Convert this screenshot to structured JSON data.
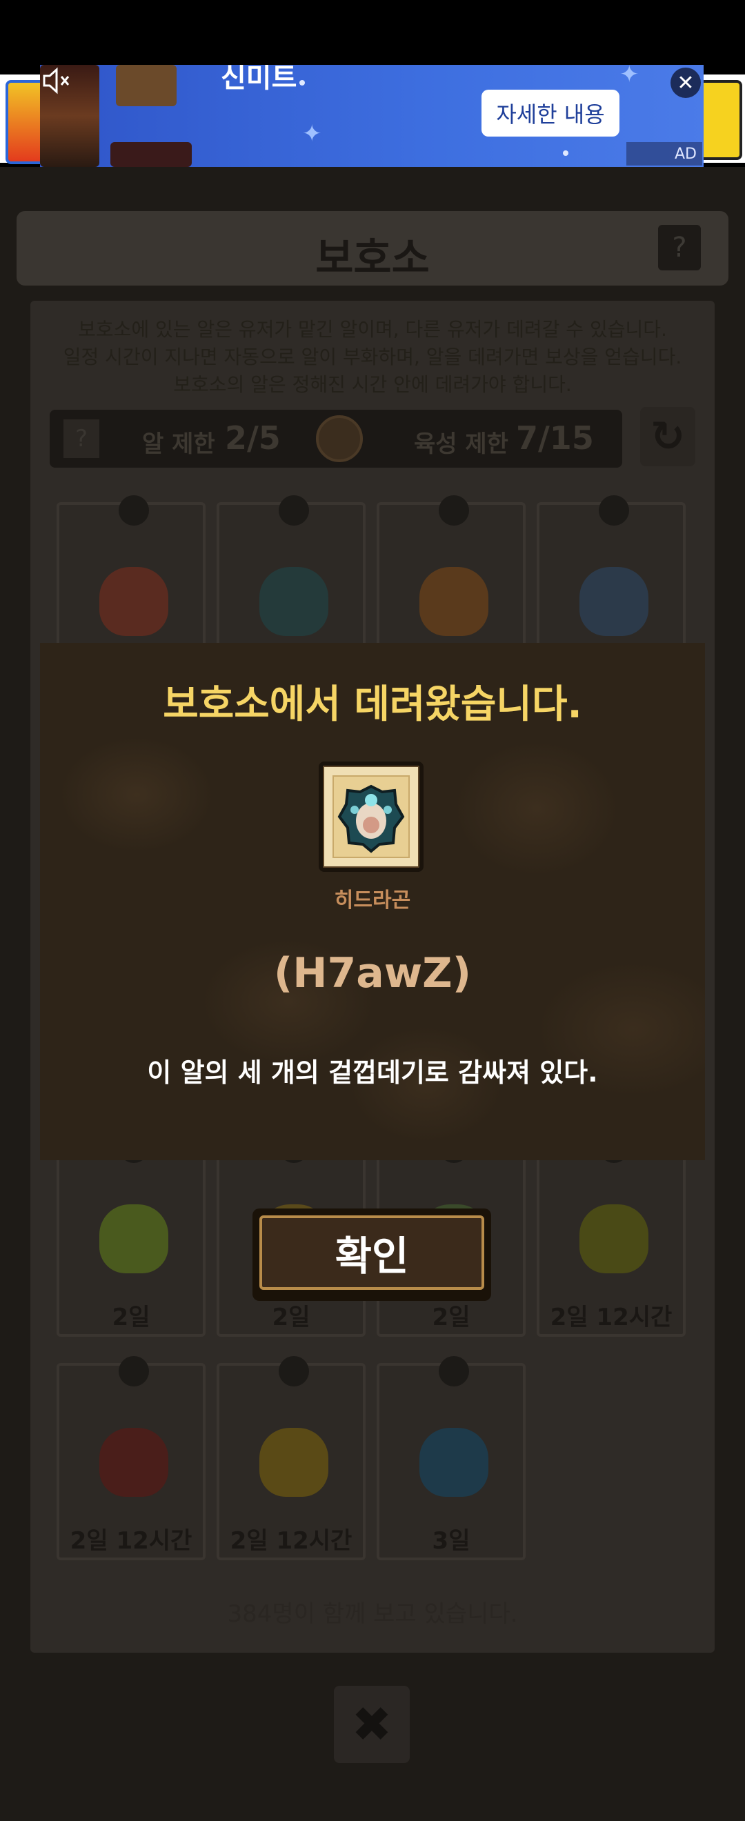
{
  "ad": {
    "title": "신미트",
    "cta_label": "자세한 내용",
    "close_label": "✕",
    "mark": "AD",
    "mute_icon": "speaker-muted-icon"
  },
  "shelter": {
    "title": "보호소",
    "help_label": "?",
    "info_lines": [
      "보호소에 있는 알은 유저가 맡긴 알이며, 다른 유저가 데려갈 수 있습니다.",
      "일정 시간이 지나면 자동으로 알이 부화하며, 알을 데려가면 보상을 얻습니다.",
      "보호소의 알은 정해진 시간 안에 데려가야 합니다."
    ],
    "egg_limit_label": "알 제한",
    "egg_limit_value": "2/5",
    "raise_limit_label": "육성 제한",
    "raise_limit_value": "7/15",
    "refresh_icon": "refresh-icon",
    "eggs": [
      {
        "time": "",
        "color": "#5a2b20"
      },
      {
        "time": "",
        "color": "#243a3a"
      },
      {
        "time": "",
        "color": "#5a3a1c"
      },
      {
        "time": "",
        "color": "#2c3a4a"
      },
      {
        "time": "2일",
        "color": "#4a5a1e"
      },
      {
        "time": "2일",
        "color": "#5a4a1a"
      },
      {
        "time": "2일",
        "color": "#3a4a2a"
      },
      {
        "time": "2일 12시간",
        "color": "#4a4a16"
      },
      {
        "time": "2일 12시간",
        "color": "#4a1e1a"
      },
      {
        "time": "2일 12시간",
        "color": "#5a4a16"
      },
      {
        "time": "3일",
        "color": "#1e3a4a"
      }
    ],
    "footer": "384명이 함께 보고 있습니다.",
    "close_label": "✖"
  },
  "modal": {
    "title": "보호소에서 데려왔습니다.",
    "reward_name": "히드라곤",
    "reward_code": "(H7awZ)",
    "description": "이 알의 세 개의 겉껍데기로 감싸져 있다.",
    "confirm_label": "확인"
  }
}
